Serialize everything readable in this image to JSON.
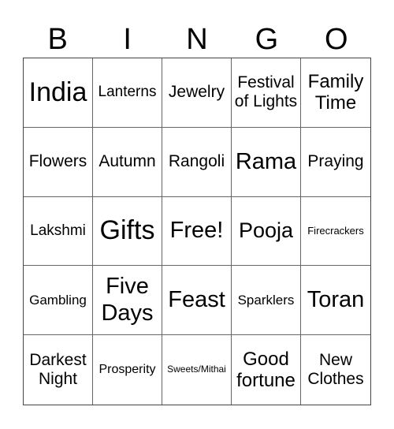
{
  "header": [
    "B",
    "I",
    "N",
    "G",
    "O"
  ],
  "cells": [
    "India",
    "Lanterns",
    "Jewelry",
    "Festival of Lights",
    "Family Time",
    "Flowers",
    "Autumn",
    "Rangoli",
    "Rama",
    "Praying",
    "Lakshmi",
    "Gifts",
    "Free!",
    "Pooja",
    "Firecrackers",
    "Gambling",
    "Five Days",
    "Feast",
    "Sparklers",
    "Toran",
    "Darkest Night",
    "Prosperity",
    "Sweets/Mithai",
    "Good fortune",
    "New Clothes"
  ]
}
